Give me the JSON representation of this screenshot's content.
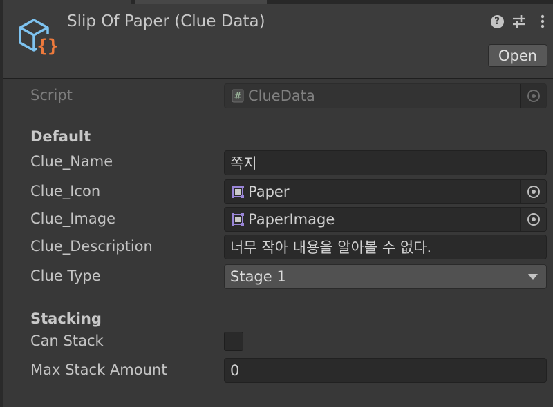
{
  "header": {
    "title": "Slip Of Paper (Clue Data)",
    "open_label": "Open",
    "help_glyph": "?",
    "icons": [
      "scriptable-object-icon",
      "help-icon",
      "preset-settings-icon",
      "kebab-menu-icon"
    ]
  },
  "script_row": {
    "label": "Script",
    "value": "ClueData",
    "icon": "script-icon"
  },
  "sections": {
    "default": "Default",
    "stacking": "Stacking"
  },
  "fields": {
    "clue_name": {
      "label": "Clue_Name",
      "value": "쪽지"
    },
    "clue_icon": {
      "label": "Clue_Icon",
      "value": "Paper",
      "icon": "sprite-icon"
    },
    "clue_image": {
      "label": "Clue_Image",
      "value": "PaperImage",
      "icon": "sprite-icon"
    },
    "clue_description": {
      "label": "Clue_Description",
      "value": "너무 작아 내용을 알아볼 수 없다."
    },
    "clue_type": {
      "label": "Clue Type",
      "value": "Stage 1"
    },
    "can_stack": {
      "label": "Can Stack",
      "checked": false
    },
    "max_stack_amount": {
      "label": "Max Stack Amount",
      "value": "0"
    }
  },
  "colors": {
    "background": "#383838",
    "field_bg": "#2a2a2a",
    "icon_blue": "#7ec3f0",
    "icon_orange": "#ee7a3c",
    "sprite_purple": "#9a86d8"
  }
}
